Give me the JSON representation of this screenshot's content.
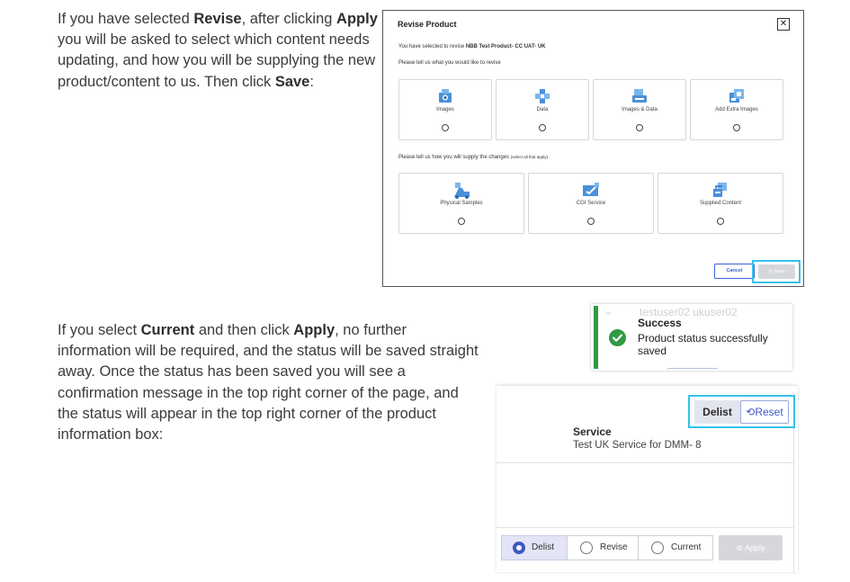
{
  "instructions": {
    "para1": {
      "t1": "If you have selected ",
      "b1": "Revise",
      "t2": ", after clicking ",
      "b2": "Apply",
      "t3": " you will be asked to select which content needs updating, and how you will be supplying the new product/content to us. Then click ",
      "b3": "Save",
      "t4": ":"
    },
    "para2": {
      "t1": "If you select ",
      "b1": "Current",
      "t2": " and then click ",
      "b2": "Apply",
      "t3": ", no further information will be required, and the status will be saved straight away. Once the status has been saved you will see a confirmation message in the top right corner of the page, and the status will appear in the top right corner of the product information box:"
    }
  },
  "revise_modal": {
    "title": "Revise Product",
    "close_symbol": "✕",
    "selected_prefix": "You have selected to revise ",
    "selected_product": "NBB Test Product- CC UAT- UK",
    "question1": "Please tell us what you would like to revise",
    "content_options": [
      {
        "label": "Images",
        "icon": "images-icon"
      },
      {
        "label": "Data",
        "icon": "data-icon"
      },
      {
        "label": "Images & Data",
        "icon": "images-data-icon"
      },
      {
        "label": "Add Extra Images",
        "icon": "add-extra-images-icon"
      }
    ],
    "question2": "Please tell us how you will supply the changes",
    "question2_hint": "(select all that apply)",
    "supply_options": [
      {
        "label": "Physical Samples",
        "icon": "physical-samples-icon"
      },
      {
        "label": "CGI Service",
        "icon": "cgi-service-icon"
      },
      {
        "label": "Supplied Content",
        "icon": "supplied-content-icon"
      }
    ],
    "cancel_label": "Cancel",
    "save_label": "Save",
    "accent_color": "#3d63d6",
    "highlight_color": "#34c3ea"
  },
  "toast": {
    "background_user": "testuser02 ukuser02",
    "title": "Success",
    "message": "Product status successfully saved",
    "status_color": "#2f9a44"
  },
  "product_info": {
    "status_badge": "Delist",
    "reset_label": "Reset",
    "service_label": "Service",
    "service_value": "Test UK Service for DMM- 8",
    "status_options": [
      {
        "label": "Delist",
        "selected": true
      },
      {
        "label": "Revise",
        "selected": false
      },
      {
        "label": "Current",
        "selected": false
      }
    ],
    "apply_label": "Apply"
  }
}
